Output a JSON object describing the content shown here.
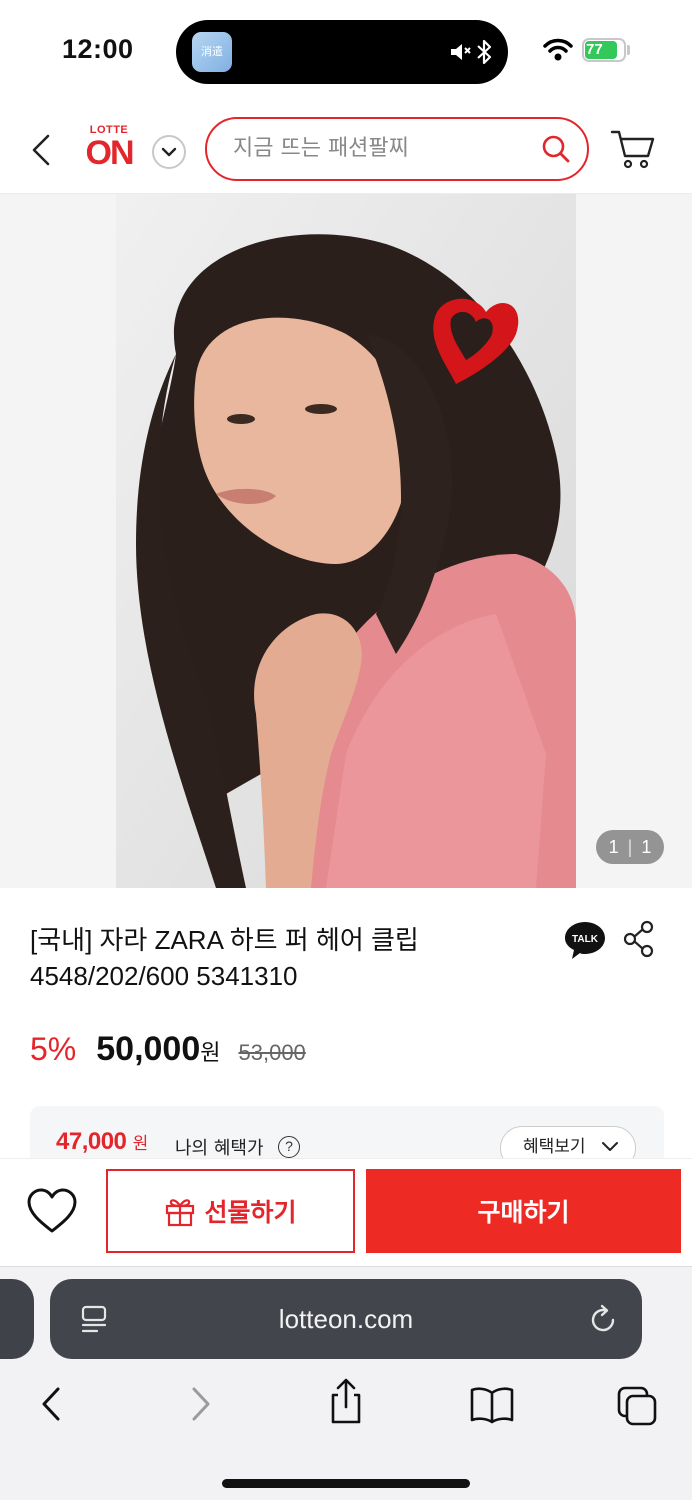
{
  "status_bar": {
    "time": "12:00",
    "battery": "77",
    "island_thumb_text": "消遣"
  },
  "header": {
    "logo_top": "LOTTE",
    "logo_main": "ON",
    "search_placeholder": "지금 뜨는 패션팔찌"
  },
  "gallery": {
    "counter_current": "1",
    "counter_total": "1"
  },
  "product": {
    "title_line1": "[국내] 자라 ZARA 하트 퍼 헤어 클립",
    "title_line2": "4548/202/600 5341310",
    "talk_label": "TALK",
    "discount": "5%",
    "price": "50,000",
    "currency": "원",
    "original_price": "53,000",
    "benefit_price": "47,000",
    "benefit_currency": "원",
    "benefit_label": "나의 혜택가",
    "benefit_button": "혜택보기"
  },
  "actions": {
    "gift_label": "선물하기",
    "buy_label": "구매하기"
  },
  "browser": {
    "url": "lotteon.com"
  },
  "colors": {
    "brand_red": "#e3262b",
    "buy_red": "#ee2a24"
  }
}
